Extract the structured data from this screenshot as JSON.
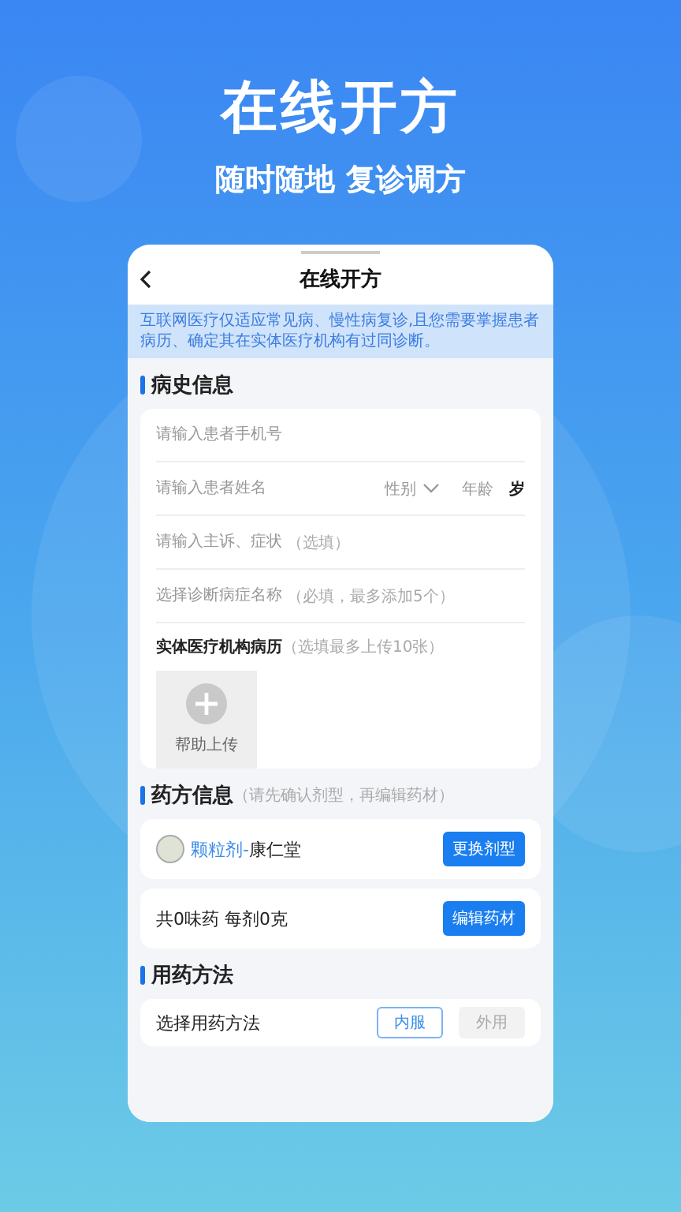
{
  "hero": {
    "title": "在线开方",
    "subtitle": "随时随地 复诊调方"
  },
  "screen": {
    "title": "在线开方",
    "notice": "互联网医疗仅适应常见病、慢性病复诊,且您需要掌握患者病历、确定其在实体医疗机构有过同诊断。"
  },
  "history": {
    "title": "病史信息",
    "fields": [
      {
        "kind": "input",
        "placeholder": "请输入患者手机号"
      },
      {
        "kind": "name",
        "placeholder": "请输入患者姓名",
        "gender": "性别",
        "age": "年龄",
        "unit": "岁"
      },
      {
        "kind": "input",
        "placeholder": "请输入主诉、症状",
        "note": "（选填）"
      },
      {
        "kind": "input",
        "placeholder": "选择诊断病症名称",
        "note": "（必填，最多添加5个）"
      }
    ],
    "record": {
      "title": "实体医疗机构病历",
      "note": "（选填最多上传10张）",
      "upload": "帮助上传"
    }
  },
  "prescription": {
    "title": "药方信息",
    "note": "（请先确认剂型，再编辑药材）",
    "form": {
      "type": "颗粒剂-",
      "pharmacy": "康仁堂",
      "button": "更换剂型"
    },
    "summary": {
      "text": "共0味药 每剂0克",
      "button": "编辑药材"
    }
  },
  "usage": {
    "title": "用药方法",
    "label": "选择用药方法",
    "options": [
      {
        "label": "内服",
        "selected": true
      },
      {
        "label": "外用",
        "selected": false
      }
    ]
  }
}
